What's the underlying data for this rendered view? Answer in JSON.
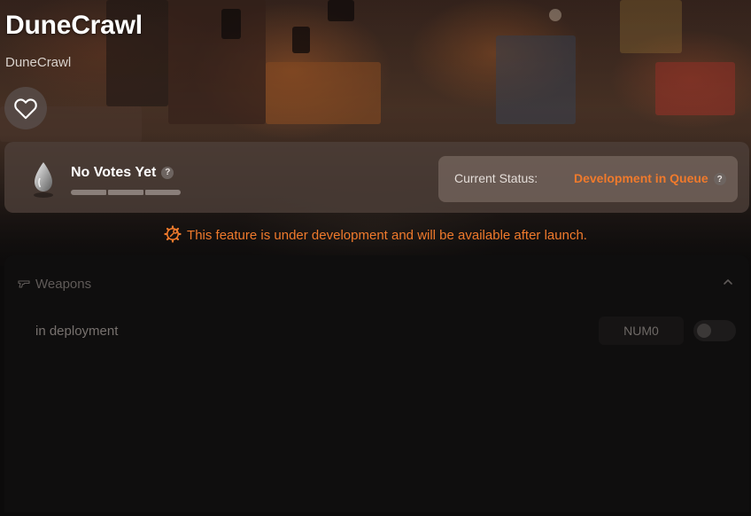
{
  "app": {
    "title": "DuneCrawl",
    "subtitle": "DuneCrawl"
  },
  "favorite": {
    "icon": "heart-outline-icon"
  },
  "votes": {
    "label": "No Votes Yet",
    "help": "?",
    "icon": "silver-drop-icon",
    "progress": 0
  },
  "status": {
    "label": "Current Status:",
    "value": "Development in Queue",
    "help": "?",
    "value_color": "#f07a2c"
  },
  "notice": {
    "text": "This feature is under development and will be available after launch.",
    "icon": "gear-wrench-icon",
    "color": "#f07a2c"
  },
  "section": {
    "title": "Weapons",
    "icon": "pistol-icon",
    "collapse_icon": "chevron-up-icon",
    "rows": [
      {
        "label": "in deployment",
        "key": "NUM0",
        "toggle_on": false
      }
    ]
  }
}
